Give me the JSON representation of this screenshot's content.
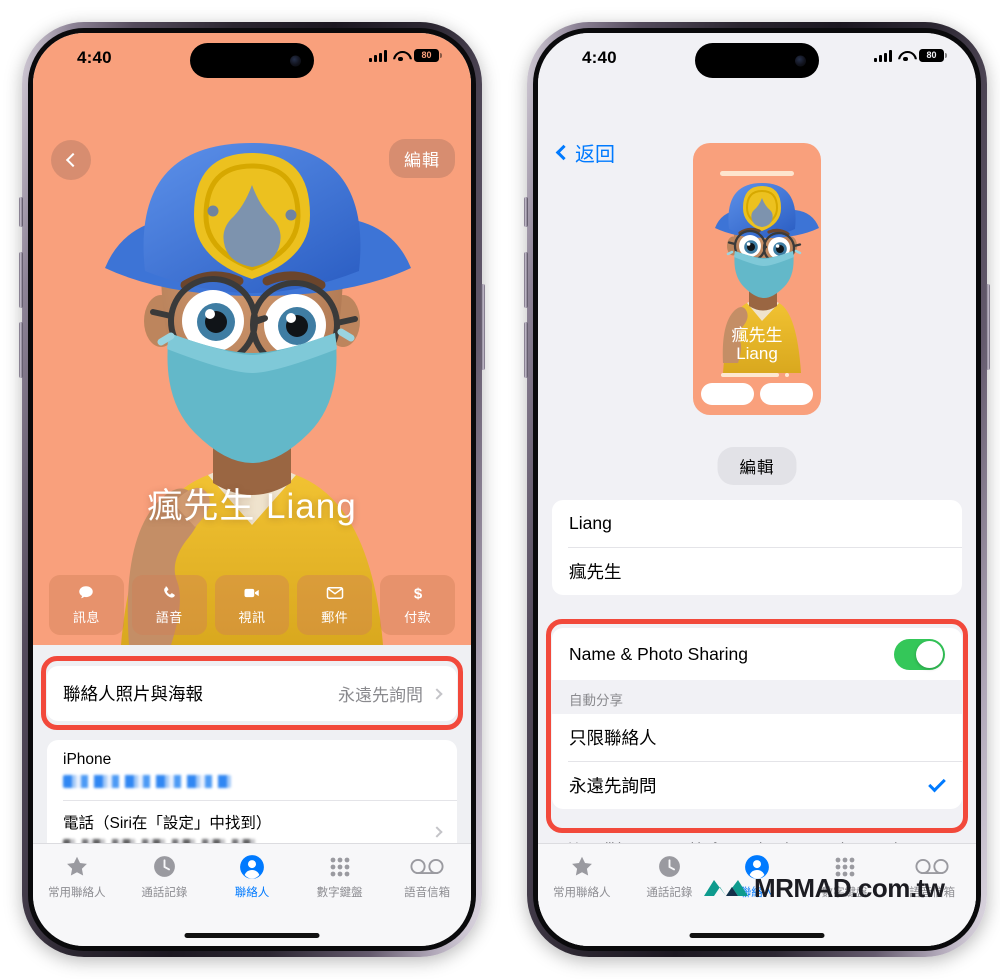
{
  "left_phone": {
    "status_bar": {
      "time": "4:40",
      "battery": "80",
      "signal_icon": "cellular-signal-icon",
      "wifi_icon": "wifi-icon",
      "battery_icon": "battery-icon"
    },
    "poster": {
      "back_icon": "back-chevron-icon",
      "edit_label": "編輯",
      "contact_name": "瘋先生 Liang",
      "background_color": "#F9A07C",
      "actions": [
        {
          "icon": "message-icon",
          "label": "訊息"
        },
        {
          "icon": "phone-icon",
          "label": "語音"
        },
        {
          "icon": "video-icon",
          "label": "視訊"
        },
        {
          "icon": "mail-icon",
          "label": "郵件"
        },
        {
          "icon": "dollar-icon",
          "label": "付款"
        }
      ]
    },
    "rows": {
      "contact_photo_poster": {
        "title": "聯絡人照片與海報",
        "value": "永遠先詢問",
        "chevron_icon": "chevron-right-icon",
        "highlighted": true
      },
      "iphone_label": "iPhone",
      "iphone_number": "[redacted phone number]",
      "siri_row": {
        "title": "電話（Siri在「設定」中找到）",
        "value": "[redacted]",
        "chevron_icon": "chevron-right-icon"
      }
    },
    "tabs": [
      {
        "icon": "star-icon",
        "label": "常用聯絡人",
        "active": false
      },
      {
        "icon": "recents-clock-icon",
        "label": "通話記錄",
        "active": false
      },
      {
        "icon": "contacts-person-icon",
        "label": "聯絡人",
        "active": true
      },
      {
        "icon": "keypad-icon",
        "label": "數字鍵盤",
        "active": false
      },
      {
        "icon": "voicemail-icon",
        "label": "語音信箱",
        "active": false
      }
    ]
  },
  "right_phone": {
    "status_bar": {
      "time": "4:40",
      "battery": "80",
      "signal_icon": "cellular-signal-icon",
      "wifi_icon": "wifi-icon",
      "battery_icon": "battery-icon"
    },
    "back_label": "返回",
    "back_icon": "back-chevron-icon",
    "poster_preview": {
      "name_line1": "瘋先生",
      "name_line2": "Liang",
      "background_color": "#F9A07C"
    },
    "edit_label": "編輯",
    "name_fields": [
      {
        "value": "Liang"
      },
      {
        "value": "瘋先生"
      }
    ],
    "sharing": {
      "toggle_label": "Name & Photo Sharing",
      "toggle_on": true,
      "toggle_color": "#34C759",
      "group_header": "自動分享",
      "options": [
        {
          "label": "只限聯絡人",
          "selected": false
        },
        {
          "label": "永遠先詢問",
          "selected": true,
          "check_icon": "checkmark-icon"
        }
      ],
      "highlighted": true
    },
    "footnote": "You will be prompted before updated name, photo, and poster are shared.",
    "tabs": [
      {
        "icon": "star-icon",
        "label": "常用聯絡人",
        "active": false
      },
      {
        "icon": "recents-clock-icon",
        "label": "通話記錄",
        "active": false
      },
      {
        "icon": "contacts-person-icon",
        "label": "聯絡人",
        "active": true
      },
      {
        "icon": "keypad-icon",
        "label": "數字鍵盤",
        "active": false
      },
      {
        "icon": "voicemail-icon",
        "label": "語音信箱",
        "active": false
      }
    ]
  },
  "watermark": {
    "text": "MRMAD.com.tw",
    "logo_icon": "mrmad-logo-icon",
    "logo_color": "#0E9B8E"
  },
  "highlight_color": "#F2493B"
}
